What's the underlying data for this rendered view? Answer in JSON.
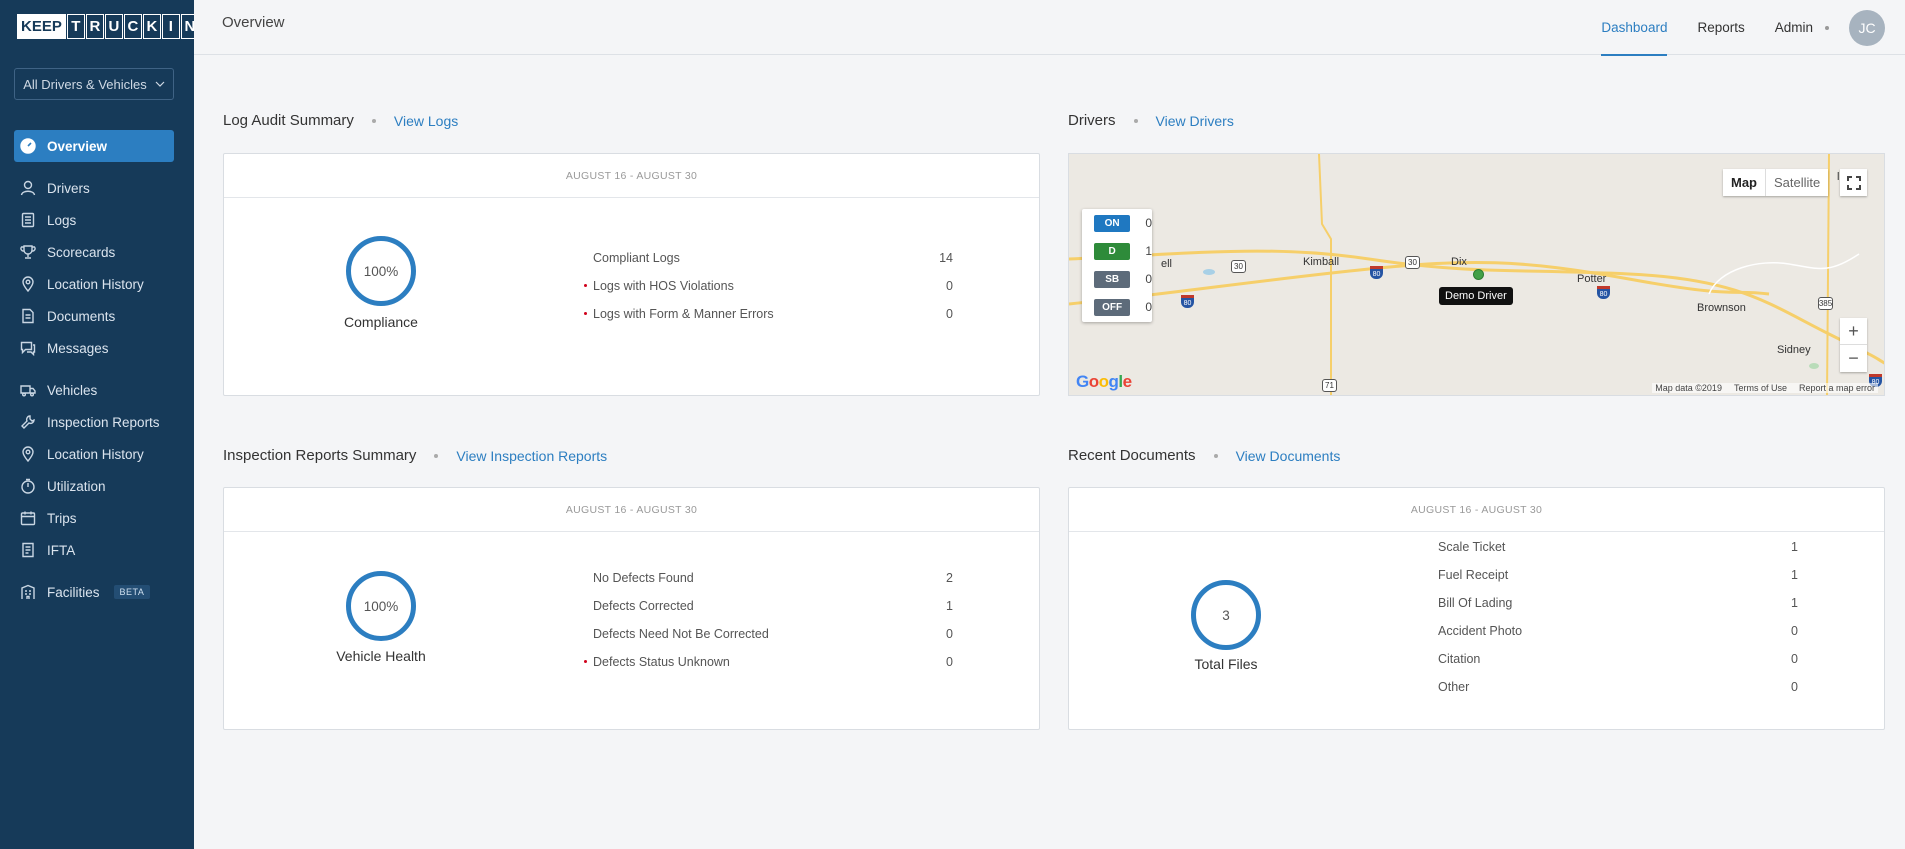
{
  "app": {
    "logo_keep": "KEEP",
    "logo_letters": [
      "T",
      "R",
      "U",
      "C",
      "K",
      "I",
      "N"
    ]
  },
  "sidebar": {
    "selector": "All Drivers & Vehicles",
    "items": [
      {
        "label": "Overview",
        "icon": "dashboard-icon"
      },
      {
        "label": "Drivers",
        "icon": "user-icon"
      },
      {
        "label": "Logs",
        "icon": "log-icon"
      },
      {
        "label": "Scorecards",
        "icon": "trophy-icon"
      },
      {
        "label": "Location History",
        "icon": "location-pin-icon"
      },
      {
        "label": "Documents",
        "icon": "document-icon"
      },
      {
        "label": "Messages",
        "icon": "message-icon"
      },
      {
        "label": "Vehicles",
        "icon": "truck-icon"
      },
      {
        "label": "Inspection Reports",
        "icon": "wrench-icon"
      },
      {
        "label": "Location History",
        "icon": "location-pin-icon"
      },
      {
        "label": "Utilization",
        "icon": "gauge-icon"
      },
      {
        "label": "Trips",
        "icon": "calendar-icon"
      },
      {
        "label": "IFTA",
        "icon": "receipt-icon"
      },
      {
        "label": "Facilities",
        "icon": "building-icon",
        "badge": "BETA"
      }
    ]
  },
  "header": {
    "title": "Overview",
    "nav": [
      "Dashboard",
      "Reports",
      "Admin"
    ],
    "active": "Dashboard",
    "avatar": "JC"
  },
  "log_audit": {
    "title": "Log Audit Summary",
    "link": "View Logs",
    "date_range": "AUGUST 16  -  AUGUST 30",
    "percent": "100%",
    "label": "Compliance",
    "rows": [
      {
        "label": "Compliant Logs",
        "value": "14"
      },
      {
        "label": "Logs with HOS Violations",
        "value": "0"
      },
      {
        "label": "Logs with Form & Manner Errors",
        "value": "0"
      }
    ]
  },
  "drivers": {
    "title": "Drivers",
    "link": "View Drivers",
    "legend": [
      {
        "tag": "ON",
        "count": "0",
        "color": "#1f78c1"
      },
      {
        "tag": "D",
        "count": "1",
        "color": "#2e8b3a"
      },
      {
        "tag": "SB",
        "count": "0",
        "color": "#5d6b7a"
      },
      {
        "tag": "OFF",
        "count": "0",
        "color": "#5d6b7a"
      }
    ],
    "map": {
      "type_map": "Map",
      "type_satellite": "Satellite",
      "zoom_in": "+",
      "zoom_out": "−",
      "towns": [
        "Kimball",
        "Dix",
        "Potter",
        "Brownson",
        "Sidney",
        "ell",
        "les"
      ],
      "driver_name": "Demo Driver",
      "google": "Google",
      "footer": [
        "Map data ©2019",
        "Terms of Use",
        "Report a map error"
      ],
      "shields": [
        "30",
        "30",
        "71",
        "385"
      ],
      "interstates": [
        "80",
        "80",
        "80",
        "80"
      ]
    }
  },
  "inspection": {
    "title": "Inspection Reports Summary",
    "link": "View Inspection Reports",
    "date_range": "AUGUST 16  -  AUGUST 30",
    "percent": "100%",
    "label": "Vehicle Health",
    "rows": [
      {
        "label": "No Defects Found",
        "value": "2"
      },
      {
        "label": "Defects Corrected",
        "value": "1"
      },
      {
        "label": "Defects Need Not Be Corrected",
        "value": "0"
      },
      {
        "label": "Defects Status Unknown",
        "value": "0"
      }
    ]
  },
  "documents": {
    "title": "Recent Documents",
    "link": "View Documents",
    "date_range": "AUGUST 16  -  AUGUST 30",
    "total": "3",
    "label": "Total Files",
    "rows": [
      {
        "label": "Scale Ticket",
        "value": "1"
      },
      {
        "label": "Fuel Receipt",
        "value": "1"
      },
      {
        "label": "Bill Of Lading",
        "value": "1"
      },
      {
        "label": "Accident Photo",
        "value": "0"
      },
      {
        "label": "Citation",
        "value": "0"
      },
      {
        "label": "Other",
        "value": "0"
      }
    ]
  }
}
